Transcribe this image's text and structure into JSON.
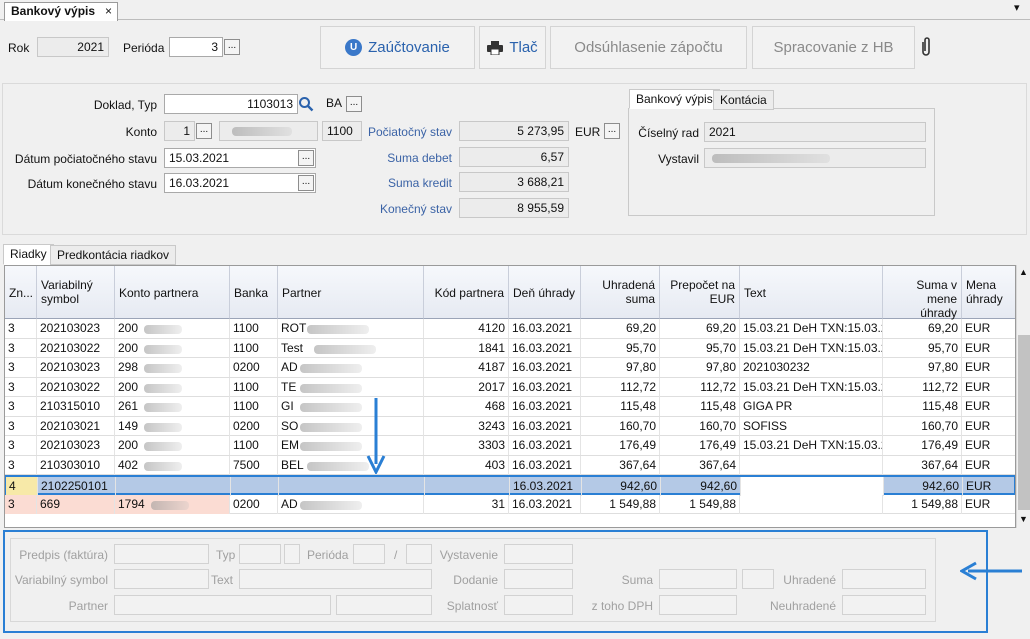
{
  "doc_tab": {
    "title": "Bankový výpis",
    "close": "×"
  },
  "window": {
    "menu_arrow": "▾"
  },
  "top": {
    "rok_label": "Rok",
    "rok_value": "2021",
    "perioda_label": "Perióda",
    "perioda_value": "3",
    "dots": "..."
  },
  "toolbar": {
    "zauctovanie": "Zaúčtovanie",
    "tlac": "Tlač",
    "odsuhlasenie": "Odsúhlasenie zápočtu",
    "spracovanie": "Spracovanie z HB"
  },
  "header": {
    "doklad_label": "Doklad, Typ",
    "doklad_value": "1103013",
    "typ_value": "BA",
    "konto_label": "Konto",
    "konto_value": "1",
    "konto_code": "1100",
    "datum_poc_label": "Dátum počiatočného stavu",
    "datum_poc_value": "15.03.2021",
    "datum_kon_label": "Dátum konečného stavu",
    "datum_kon_value": "16.03.2021",
    "pociatocny_label": "Počiatočný stav",
    "pociatocny_value": "5 273,95",
    "mena": "EUR",
    "debet_label": "Suma debet",
    "debet_value": "6,57",
    "kredit_label": "Suma kredit",
    "kredit_value": "3 688,21",
    "konecny_label": "Konečný stav",
    "konecny_value": "8 955,59"
  },
  "right_panel": {
    "tabs": [
      "Bankový výpis",
      "Kontácia"
    ],
    "ciselny_label": "Číselný rad",
    "ciselny_value": "2021",
    "vystavil_label": "Vystavil"
  },
  "grid_tabs": [
    "Riadky",
    "Predkontácia riadkov"
  ],
  "grid": {
    "columns": [
      "Zn...",
      "Variabilný symbol",
      "Konto partnera",
      "Banka",
      "Partner",
      "Kód partnera",
      "Deň úhrady",
      "Uhradená suma",
      "Prepočet na EUR",
      "Text",
      "Suma v mene úhrady",
      "Mena úhrady"
    ],
    "rows": [
      {
        "zn": "3",
        "vs": "202103023",
        "konto": "200",
        "banka": "1100",
        "partner": "ROT",
        "kod": "4120",
        "den": "16.03.2021",
        "suma": "69,20",
        "eur": "69,20",
        "text": "15.03.21  DeH TXN:15.03.2...",
        "mena_suma": "69,20",
        "mena": "EUR"
      },
      {
        "zn": "3",
        "vs": "202103022",
        "konto": "200",
        "banka": "1100",
        "partner": "Test",
        "kod": "1841",
        "den": "16.03.2021",
        "suma": "95,70",
        "eur": "95,70",
        "text": "15.03.21  DeH TXN:15.03.2...",
        "mena_suma": "95,70",
        "mena": "EUR"
      },
      {
        "zn": "3",
        "vs": "202103023",
        "konto": "298",
        "banka": "0200",
        "partner": "AD",
        "kod": "4187",
        "den": "16.03.2021",
        "suma": "97,80",
        "eur": "97,80",
        "text": "2021030232",
        "mena_suma": "97,80",
        "mena": "EUR"
      },
      {
        "zn": "3",
        "vs": "202103022",
        "konto": "200",
        "banka": "1100",
        "partner": "TE",
        "kod": "2017",
        "den": "16.03.2021",
        "suma": "112,72",
        "eur": "112,72",
        "text": "15.03.21  DeH TXN:15.03.2...",
        "mena_suma": "112,72",
        "mena": "EUR"
      },
      {
        "zn": "3",
        "vs": "210315010",
        "konto": "261",
        "banka": "1100",
        "partner": "GI",
        "kod": "468",
        "den": "16.03.2021",
        "suma": "115,48",
        "eur": "115,48",
        "text": "GIGA PR",
        "mena_suma": "115,48",
        "mena": "EUR"
      },
      {
        "zn": "3",
        "vs": "202103021",
        "konto": "149",
        "banka": "0200",
        "partner": "SO",
        "kod": "3243",
        "den": "16.03.2021",
        "suma": "160,70",
        "eur": "160,70",
        "text": "SOFISS",
        "mena_suma": "160,70",
        "mena": "EUR"
      },
      {
        "zn": "3",
        "vs": "202103023",
        "konto": "200",
        "banka": "1100",
        "partner": "EM",
        "kod": "3303",
        "den": "16.03.2021",
        "suma": "176,49",
        "eur": "176,49",
        "text": "15.03.21  DeH TXN:15.03.2...",
        "mena_suma": "176,49",
        "mena": "EUR"
      },
      {
        "zn": "3",
        "vs": "210303010",
        "konto": "402",
        "banka": "7500",
        "partner": "BEL",
        "kod": "403",
        "den": "16.03.2021",
        "suma": "367,64",
        "eur": "367,64",
        "text": "",
        "mena_suma": "367,64",
        "mena": "EUR"
      },
      {
        "zn": "4",
        "vs": "2102250101",
        "konto": "",
        "banka": "",
        "partner": "",
        "kod": "",
        "den": "16.03.2021",
        "suma": "942,60",
        "eur": "942,60",
        "text": "",
        "mena_suma": "942,60",
        "mena": "EUR"
      },
      {
        "zn": "3",
        "vs": "669",
        "konto": "1794",
        "banka": "0200",
        "partner": "AD",
        "kod": "31",
        "den": "16.03.2021",
        "suma": "1 549,88",
        "eur": "1 549,88",
        "text": "",
        "mena_suma": "1 549,88",
        "mena": "EUR"
      }
    ]
  },
  "bottom": {
    "predpis_label": "Predpis (faktúra)",
    "typ_label": "Typ",
    "perioda_label": "Perióda",
    "slash": "/",
    "vystavenie_label": "Vystavenie",
    "vs_label": "Variabilný symbol",
    "text_label": "Text",
    "dodanie_label": "Dodanie",
    "suma_label": "Suma",
    "uhradene_label": "Uhradené",
    "partner_label": "Partner",
    "splatnost_label": "Splatnosť",
    "dph_label": "z toho DPH",
    "neuhradene_label": "Neuhradené"
  },
  "colors": {
    "accent": "#2a7fd4",
    "selected_row": "#b4c9e6",
    "pink_cell": "#fbdcd3"
  }
}
